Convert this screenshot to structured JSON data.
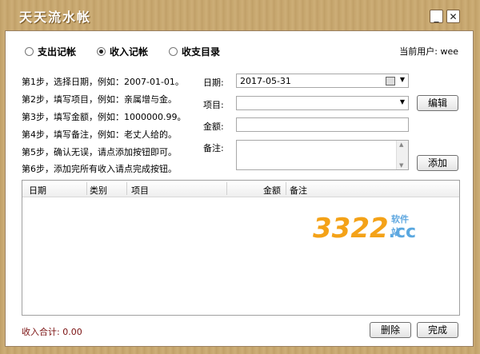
{
  "window": {
    "title": "天天流水帐",
    "minimize_label": "_",
    "close_label": "✕"
  },
  "modes": [
    {
      "label": "支出记帐",
      "selected": false
    },
    {
      "label": "收入记帐",
      "selected": true
    },
    {
      "label": "收支目录",
      "selected": false
    }
  ],
  "current_user": "当前用户: wee",
  "steps": [
    "第1步，选择日期，例如：2007-01-01。",
    "第2步，填写项目，例如：亲属增与金。",
    "第3步，填写金额，例如：1000000.99。",
    "第4步，填写备注，例如：老丈人给的。",
    "第5步，确认无误，请点添加按钮即可。",
    "第6步，添加完所有收入请点完成按钮。"
  ],
  "form": {
    "date_label": "日期:",
    "date_value": "2017-05-31",
    "item_label": "项目:",
    "item_value": "",
    "amount_label": "金额:",
    "amount_value": "",
    "note_label": "备注:",
    "note_value": "",
    "edit_button": "编辑",
    "add_button": "添加"
  },
  "table": {
    "columns": [
      "日期",
      "类别",
      "项目",
      "金额",
      "备注"
    ],
    "rows": []
  },
  "total": "收入合计: 0.00",
  "footer": {
    "delete_button": "删除",
    "done_button": "完成"
  },
  "watermark": {
    "number": "3322",
    "suffix": ".cc",
    "site": "软件站"
  },
  "colors": {
    "window_frame": "#c8a870",
    "total_text": "#7a1010",
    "watermark_orange": "#f4a218",
    "watermark_blue": "#5aa8e0"
  }
}
